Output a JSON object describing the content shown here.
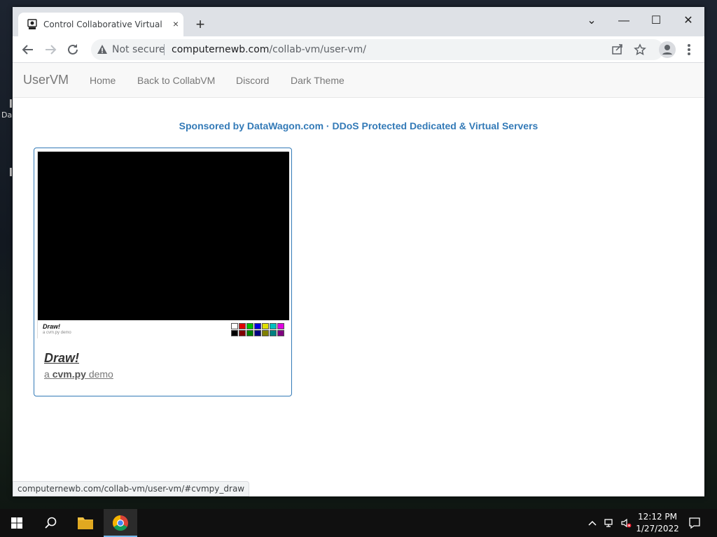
{
  "desktop": {
    "left_text": "Da"
  },
  "browser": {
    "tab_title": "Control Collaborative Virtual Ma",
    "tab_close": "×",
    "new_tab": "+",
    "window_controls": {
      "dropdown": "⌄",
      "minimize": "—",
      "maximize": "☐",
      "close": "✕"
    },
    "not_secure": "Not secure",
    "url_domain": "computernewb.com",
    "url_path": "/collab-vm/user-vm/",
    "status_url": "computernewb.com/collab-vm/user-vm/#cvmpy_draw"
  },
  "navbar": {
    "brand": "UserVM",
    "links": [
      "Home",
      "Back to CollabVM",
      "Discord",
      "Dark Theme"
    ]
  },
  "sponsor": "Sponsored by DataWagon.com · DDoS Protected Dedicated & Virtual Servers",
  "card": {
    "thumb_title": "Draw!",
    "thumb_subtitle": "a cvm.py demo",
    "palette": [
      "#ffffff",
      "#e00000",
      "#00c000",
      "#0000e0",
      "#e0e000",
      "#00c0c0",
      "#e000e0",
      "#000000",
      "#800000",
      "#008000",
      "#000080",
      "#808000",
      "#008080",
      "#800080"
    ],
    "title": "Draw!",
    "desc_prefix": "a ",
    "desc_strong": "cvm.py",
    "desc_suffix": " demo"
  },
  "taskbar": {
    "time": "12:12 PM",
    "date": "1/27/2022",
    "accent": "#76b9ed"
  }
}
